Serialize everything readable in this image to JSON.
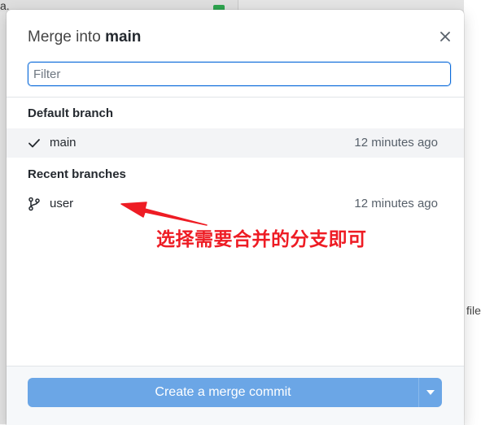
{
  "background": {
    "fragment_top": "a.",
    "fragment_right": "file"
  },
  "dialog": {
    "title_prefix": "Merge into",
    "title_branch": "main",
    "close_icon": "close-icon"
  },
  "filter": {
    "placeholder": "Filter",
    "value": ""
  },
  "sections": {
    "default_label": "Default branch",
    "recent_label": "Recent branches"
  },
  "branches": {
    "default": {
      "name": "main",
      "time": "12 minutes ago",
      "icon": "check-icon",
      "selected": true
    },
    "recent": [
      {
        "name": "user",
        "time": "12 minutes ago",
        "icon": "git-branch-icon"
      }
    ]
  },
  "annotation": {
    "text": "选择需要合并的分支即可",
    "color": "#ee1c24"
  },
  "footer": {
    "merge_button_label": "Create a merge commit",
    "dropdown_icon": "caret-down-icon",
    "button_color": "#6ba6e6"
  }
}
